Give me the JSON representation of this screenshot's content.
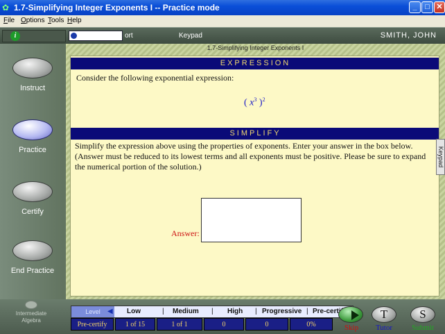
{
  "window": {
    "title": "1.7-Simplifying Integer Exponents I -- Practice mode"
  },
  "menu": [
    "File",
    "Options",
    "Tools",
    "Help"
  ],
  "status": {
    "progress_label": "ort",
    "keypad_label": "Keypad",
    "user_name": "SMITH, JOHN"
  },
  "nav": [
    {
      "label": "Instruct",
      "active": false
    },
    {
      "label": "Practice",
      "active": true
    },
    {
      "label": "Certify",
      "active": false
    },
    {
      "label": "End Practice",
      "active": false
    }
  ],
  "section_caption": "1.7-Simplifying Integer Exponents I",
  "expression_panel": {
    "header": "EXPRESSION",
    "prompt": "Consider the following exponential expression:",
    "base": "x",
    "inner_exponent": "3",
    "outer_exponent": "2"
  },
  "simplify_panel": {
    "header": "SIMPLIFY",
    "instructions": "Simplify the expression above using the properties of exponents.  Enter your answer in the box below.  (Answer must be reduced to its lowest terms and all exponents must be positive.  Please be sure to expand the numerical portion of the solution.)",
    "answer_label": "Answer:",
    "answer_value": ""
  },
  "side_tab": "Keypad",
  "logo": {
    "line1": "Intermediate",
    "line2": "Algebra"
  },
  "level": {
    "key": "Level",
    "columns": [
      "Low",
      "Medium",
      "High",
      "Progressive",
      "Pre-certify"
    ],
    "values": [
      "Pre-certify",
      "1 of 15",
      "1 of 1",
      "0",
      "0",
      "0%"
    ]
  },
  "actions": [
    {
      "letter": "",
      "label": "Skip",
      "color": "#cc1111"
    },
    {
      "letter": "T",
      "label": "Tutor",
      "color": "#1515c8"
    },
    {
      "letter": "S",
      "label": "Submit",
      "color": "#22aa22"
    }
  ]
}
